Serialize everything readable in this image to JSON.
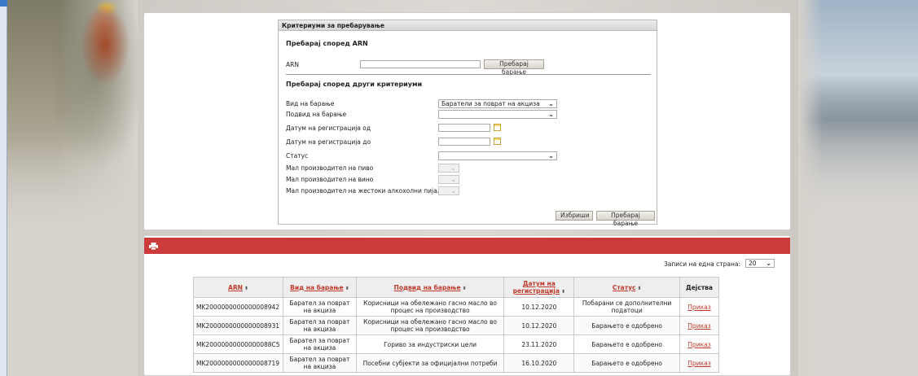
{
  "search": {
    "header": "Критериуми за пребарување",
    "arn_section_title": "Пребарај според ARN",
    "arn_label": "ARN",
    "arn_value": "",
    "arn_search_button": "Пребарај барање",
    "other_section_title": "Пребарај според други критериуми",
    "fields": [
      {
        "label": "Вид на барање",
        "value": "Баратели за поврат на акциза"
      },
      {
        "label": "Подвид на барање",
        "value": ""
      },
      {
        "label": "Датум на регистрација од",
        "value": ""
      },
      {
        "label": "Датум на регистрација до",
        "value": ""
      },
      {
        "label": "Статус",
        "value": ""
      },
      {
        "label": "Мал производител на пиво",
        "value": ""
      },
      {
        "label": "Мал производител на вино",
        "value": ""
      },
      {
        "label": "Мал производител на жестоки алкохолни пијалаци",
        "value": ""
      }
    ],
    "clear_button": "Избриши",
    "search_button": "Пребарај барање"
  },
  "results": {
    "per_page_label": "Записи на една страна:",
    "per_page_value": "20",
    "columns": [
      "ARN",
      "Вид на барање",
      "Подвид на барање",
      "Датум на регистрација",
      "Статус",
      "Дејства"
    ],
    "rows": [
      {
        "arn": "MK2000000000000008942",
        "type": "Барател за поврат на акциза",
        "subtype": "Корисници на обележано гасно масло во процес на производство",
        "date": "10.12.2020",
        "status": "Побарани се дополнителни податоци",
        "action": "Приказ"
      },
      {
        "arn": "MK2000000000000008931",
        "type": "Барател за поврат на акциза",
        "subtype": "Корисници на обележано гасно масло во процес на производство",
        "date": "10.12.2020",
        "status": "Барањето е одобрено",
        "action": "Приказ"
      },
      {
        "arn": "MK20000000000000088C5",
        "type": "Барател за поврат на акциза",
        "subtype": "Гориво за индустриски цели",
        "date": "23.11.2020",
        "status": "Барањето е одобрено",
        "action": "Приказ"
      },
      {
        "arn": "MK2000000000000008719",
        "type": "Барател за поврат на акциза",
        "subtype": "Посебни субјекти за официјални потреби",
        "date": "16.10.2020",
        "status": "Барањето е одобрено",
        "action": "Приказ"
      }
    ]
  },
  "colors": {
    "red_bar": "#cc3b3b",
    "link": "#c0392b"
  },
  "icons": [
    "print-icon",
    "calendar-icon",
    "chevron-down-icon",
    "sort-icon"
  ]
}
